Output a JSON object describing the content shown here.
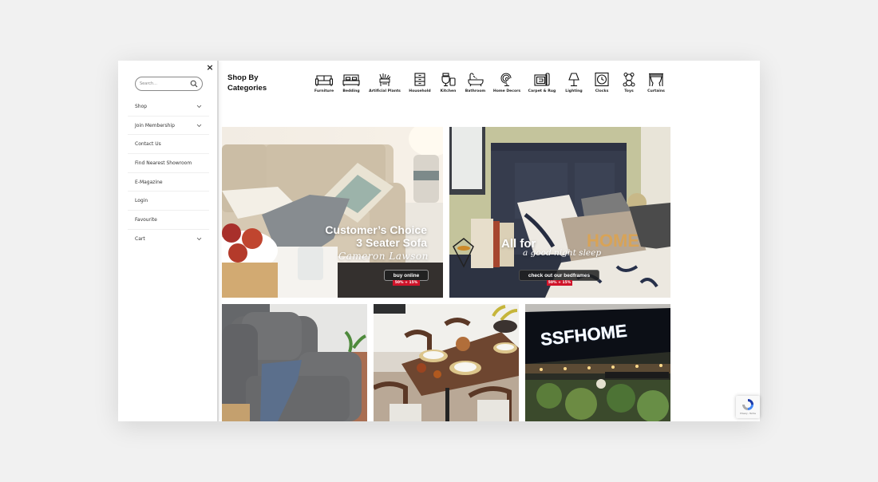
{
  "sidebar": {
    "close_label": "×",
    "search_placeholder": "Search...",
    "items": [
      {
        "label": "Shop",
        "has_submenu": true
      },
      {
        "label": "Join Membership",
        "has_submenu": true
      },
      {
        "label": "Contact Us",
        "has_submenu": false
      },
      {
        "label": "Find Nearest Showroom",
        "has_submenu": false
      },
      {
        "label": "E-Magazine",
        "has_submenu": false
      },
      {
        "label": "Login",
        "has_submenu": false
      },
      {
        "label": "Favourite",
        "has_submenu": false
      },
      {
        "label": "Cart",
        "has_submenu": true
      }
    ]
  },
  "categories": {
    "title_line1": "Shop By",
    "title_line2": "Categories",
    "items": [
      {
        "label": "Furniture",
        "icon": "sofa-icon"
      },
      {
        "label": "Bedding",
        "icon": "bed-icon"
      },
      {
        "label": "Artificial Plants",
        "icon": "plant-icon"
      },
      {
        "label": "Household",
        "icon": "drawers-icon"
      },
      {
        "label": "Kitchen",
        "icon": "kitchen-icon"
      },
      {
        "label": "Bathroom",
        "icon": "bathtub-icon"
      },
      {
        "label": "Home Decors",
        "icon": "shell-decor-icon"
      },
      {
        "label": "Carpet & Rug",
        "icon": "rug-icon"
      },
      {
        "label": "Lighting",
        "icon": "lamp-icon"
      },
      {
        "label": "Clocks",
        "icon": "clock-icon"
      },
      {
        "label": "Toys",
        "icon": "teddy-bear-icon"
      },
      {
        "label": "Curtains",
        "icon": "curtains-icon"
      }
    ]
  },
  "banners": {
    "sofa": {
      "headline_line1": "Customer’s Choice",
      "headline_line2": "3 Seater Sofa",
      "script": "Cameron Lawson",
      "cta": "buy online",
      "discount": "50% + 15%"
    },
    "bed": {
      "headline": "All for",
      "script": "a good night sleep",
      "cta": "check out our bedframes",
      "discount": "50% + 15%",
      "pillow_text": "HOME"
    },
    "showroom": {
      "sign_text": "SSFHOME"
    }
  },
  "recaptcha": {
    "text": "Privacy - Terms"
  },
  "colors": {
    "discount_red": "#d0142a",
    "page_bg": "#f1f1f1"
  }
}
